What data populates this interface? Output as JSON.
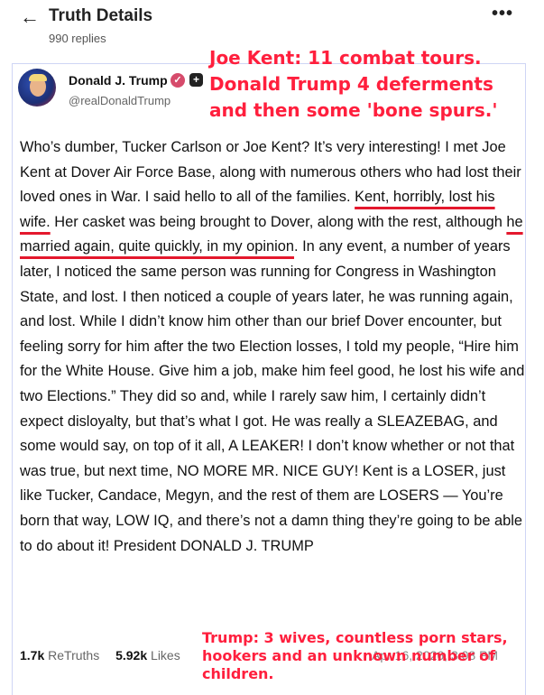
{
  "header": {
    "back_icon": "arrow-left-icon",
    "title": "Truth Details",
    "replies": "990 replies",
    "more_icon": "more-horizontal-icon"
  },
  "post": {
    "author_name": "Donald J. Trump",
    "author_handle": "@realDonaldTrump",
    "verified_icon": "verified-badge-icon",
    "paragraph_parts": [
      {
        "text": "Who’s dumber, Tucker Carlson or Joe Kent? It’s very interesting! I met Joe Kent at Dover Air Force Base, along with numerous others who had lost their loved ones in War. I said hello to all of the families. ",
        "underline": false
      },
      {
        "text": "Kent, horribly, lost his wife.",
        "underline": true
      },
      {
        "text": " Her casket was being brought to Dover, along with the rest, although ",
        "underline": false
      },
      {
        "text": "he married again, quite quickly, in my opinion",
        "underline": true
      },
      {
        "text": ". In any event, a number of years later, I noticed the same person was running for Congress in Washington State, and lost. I then noticed a couple of years later, he was running again, and lost. While I didn’t know him other than our brief Dover encounter, but feeling sorry for him after the two Election losses, I told my people, “Hire him for the White House. Give him a job, make him feel good, he lost his wife and two Elections.” They did so and, while I rarely saw him, I certainly didn’t expect disloyalty, but that’s what I got. He was really a SLEAZEBAG, and some would say, on top of it all, A LEAKER! I don’t know whether or not that was true, but next time, NO MORE MR. NICE GUY! Kent is a LOSER, just like Tucker, Candace, Megyn, and the rest of them are LOSERS — You’re born that way, LOW IQ, and there’s not a damn thing they’re going to be able to do about it! President DONALD J. TRUMP",
        "underline": false
      }
    ],
    "retruths_count": "1.7k",
    "retruths_label": "ReTruths",
    "likes_count": "5.92k",
    "likes_label": "Likes",
    "timestamp": "Apr 16, 2026, 3:08 PM"
  },
  "overlay": {
    "top_lines": [
      "Joe Kent: 11 combat tours.",
      "Donald Trump 4 deferments",
      "and then some 'bone spurs.'"
    ],
    "bottom_text": "Trump: 3 wives, countless porn stars, hookers and an unknown number of children."
  },
  "colors": {
    "annotation": "#ff1f3d",
    "card_border": "#cfd5f5"
  }
}
